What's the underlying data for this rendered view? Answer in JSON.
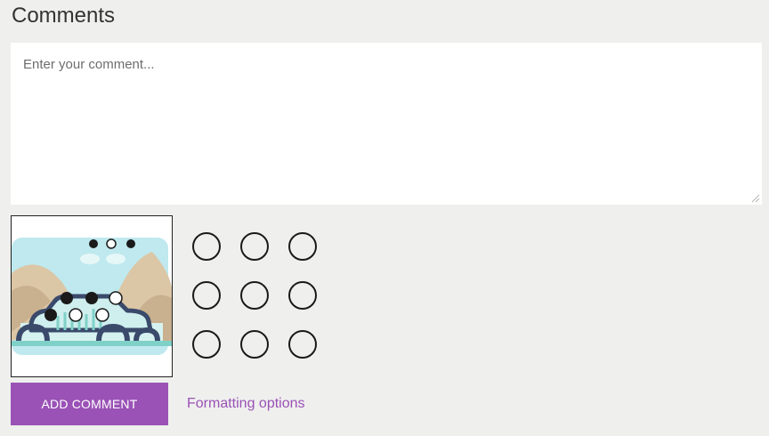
{
  "comments": {
    "title": "Comments",
    "placeholder": "Enter your comment...",
    "value": ""
  },
  "image": {
    "icon": "offroad-car-illustration"
  },
  "swatches": {
    "count": 9,
    "icon": "circle-outline-icon"
  },
  "actions": {
    "add_comment_label": "ADD COMMENT",
    "formatting_label": "Formatting options"
  },
  "colors": {
    "accent": "#9a52b6",
    "background": "#efefee",
    "input_bg": "#ffffff",
    "title_text": "#333333"
  }
}
